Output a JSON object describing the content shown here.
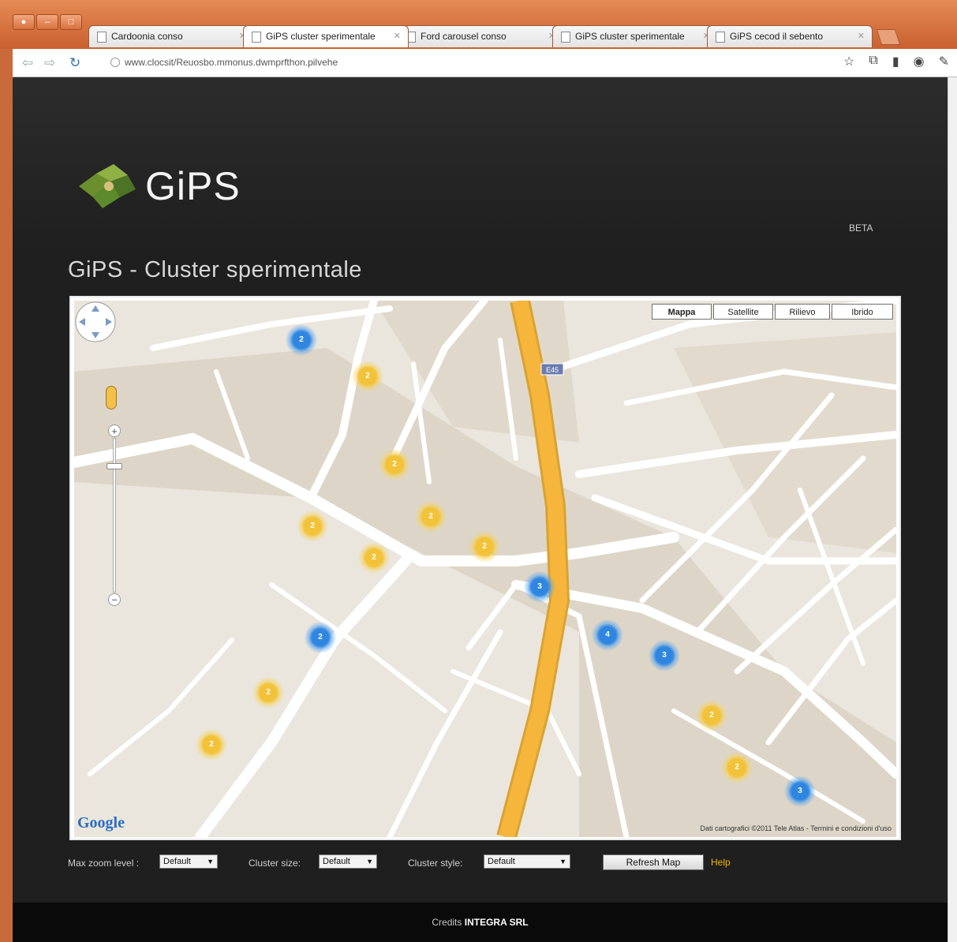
{
  "window": {
    "controls": [
      "●",
      "–",
      "□"
    ]
  },
  "tabs": [
    {
      "label": "Cardoonia conso",
      "active": false
    },
    {
      "label": "GiPS cluster sperimentale",
      "active": true
    },
    {
      "label": "Ford carousel conso",
      "active": false
    },
    {
      "label": "GiPS cluster sperimentale",
      "active": false
    },
    {
      "label": "GiPS cecod il sebento",
      "active": false
    }
  ],
  "toolbar": {
    "url": "www.clocsit/Reuosbo.mmonus.dwmprfthon.pilvehe"
  },
  "page": {
    "logo_text": "GiPS",
    "beta": "BETA",
    "title": "GiPS - Cluster sperimentale"
  },
  "map": {
    "types": [
      "Mappa",
      "Satellite",
      "Rilievo",
      "Ibrido"
    ],
    "selected_type": "Mappa",
    "google": "Google",
    "attribution": "Dati cartografici ©2011 Tele Atlas - Termini e condizioni d'uso",
    "highway_shield": "E45",
    "clusters": [
      {
        "color": "blue",
        "label": "2"
      },
      {
        "color": "yellow",
        "label": "2"
      },
      {
        "color": "yellow",
        "label": "2"
      },
      {
        "color": "yellow",
        "label": "2"
      },
      {
        "color": "yellow",
        "label": "2"
      },
      {
        "color": "yellow",
        "label": "2"
      },
      {
        "color": "yellow",
        "label": "2"
      },
      {
        "color": "blue",
        "label": "3"
      },
      {
        "color": "blue",
        "label": "2"
      },
      {
        "color": "blue",
        "label": "4"
      },
      {
        "color": "blue",
        "label": "3"
      },
      {
        "color": "yellow",
        "label": "2"
      },
      {
        "color": "yellow",
        "label": "2"
      },
      {
        "color": "yellow",
        "label": "2"
      },
      {
        "color": "yellow",
        "label": "2"
      },
      {
        "color": "blue",
        "label": "3"
      }
    ]
  },
  "controls": {
    "max_zoom_label": "Max zoom level :",
    "max_zoom_value": "Default",
    "cluster_size_label": "Cluster size:",
    "cluster_size_value": "Default",
    "cluster_style_label": "Cluster style:",
    "cluster_style_value": "Default",
    "refresh_label": "Refresh Map",
    "help_label": "Help"
  },
  "footer": {
    "prefix": "Credits",
    "company": "INTEGRA SRL"
  }
}
